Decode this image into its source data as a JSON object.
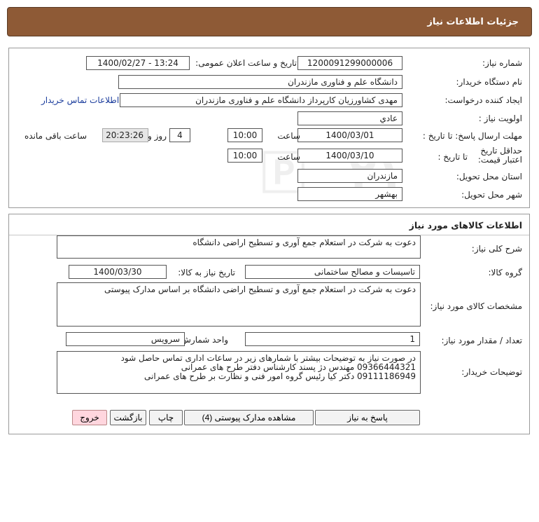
{
  "header": {
    "title": "جزئیات اطلاعات نیاز"
  },
  "need": {
    "number_label": "شماره نیاز:",
    "number": "1200091299000006",
    "announce_label": "تاریخ و ساعت اعلان عمومی:",
    "announce": "1400/02/27 - 13:24",
    "buyer_label": "نام دستگاه خریدار:",
    "buyer": "دانشگاه علم و فناوری مازندران",
    "creator_label": "ایجاد کننده درخواست:",
    "creator": "مهدی  کشاورزیان کارپرداز دانشگاه علم و فناوری مازندران",
    "contact_link": "اطلاعات تماس خریدار",
    "priority_label": "اولویت نیاز :",
    "priority": "عادي",
    "deadline_label": "مهلت ارسال پاسخ: تا تاریخ :",
    "deadline_date": "1400/03/01",
    "time_label": "ساعت",
    "deadline_time": "10:00",
    "days": "4",
    "days_label": "روز و",
    "remaining": "20:23:26",
    "remaining_label": "ساعت باقی مانده",
    "validity_label": "حداقل تاریخ اعتبار قیمت:",
    "validity_until_label": "تا تاریخ :",
    "validity_date": "1400/03/10",
    "validity_time_label": "ساعت",
    "validity_time": "10:00",
    "province_label": "استان محل تحویل:",
    "province": "مازندران",
    "city_label": "شهر محل تحویل:",
    "city": "بهشهر"
  },
  "goods": {
    "section_title": "اطلاعات کالاهای مورد نیاز",
    "summary_label": "شرح کلی نیاز:",
    "summary": "دعوت به شرکت در استعلام جمع آوری و تسطیح اراضی دانشگاه",
    "group_label": "گروه کالا:",
    "group": "تاسیسات و مصالح ساختمانی",
    "need_date_label": "تاریخ نیاز به کالا:",
    "need_date": "1400/03/30",
    "spec_label": "مشخصات کالای مورد نیاز:",
    "spec": "دعوت به شرکت در استعلام جمع آوری و تسطیح اراضی دانشگاه بر اساس مدارک پیوستی",
    "qty_label": "تعداد / مقدار مورد نیاز:",
    "qty": "1",
    "unit_label": "واحد شمارش:",
    "unit": "سرویس",
    "notes_label": "توضیحات خریدار:",
    "notes_lines": [
      "در صورت نیاز به توضیحات بیشتر با شمارهای زیر در ساعات اداری تماس حاصل شود",
      "09366444321 مهندس دژ پسند کارشناس دفتر طرح های عمرانی",
      "09111186949 دکتر کیا رئیس گروه امور فنی و نظارت بر طرح های عمرانی"
    ]
  },
  "buttons": {
    "reply": "پاسخ به نیاز",
    "attachments": "مشاهده مدارک پیوستی (4)",
    "print": "چاپ",
    "back": "بازگشت",
    "exit": "خروج"
  }
}
